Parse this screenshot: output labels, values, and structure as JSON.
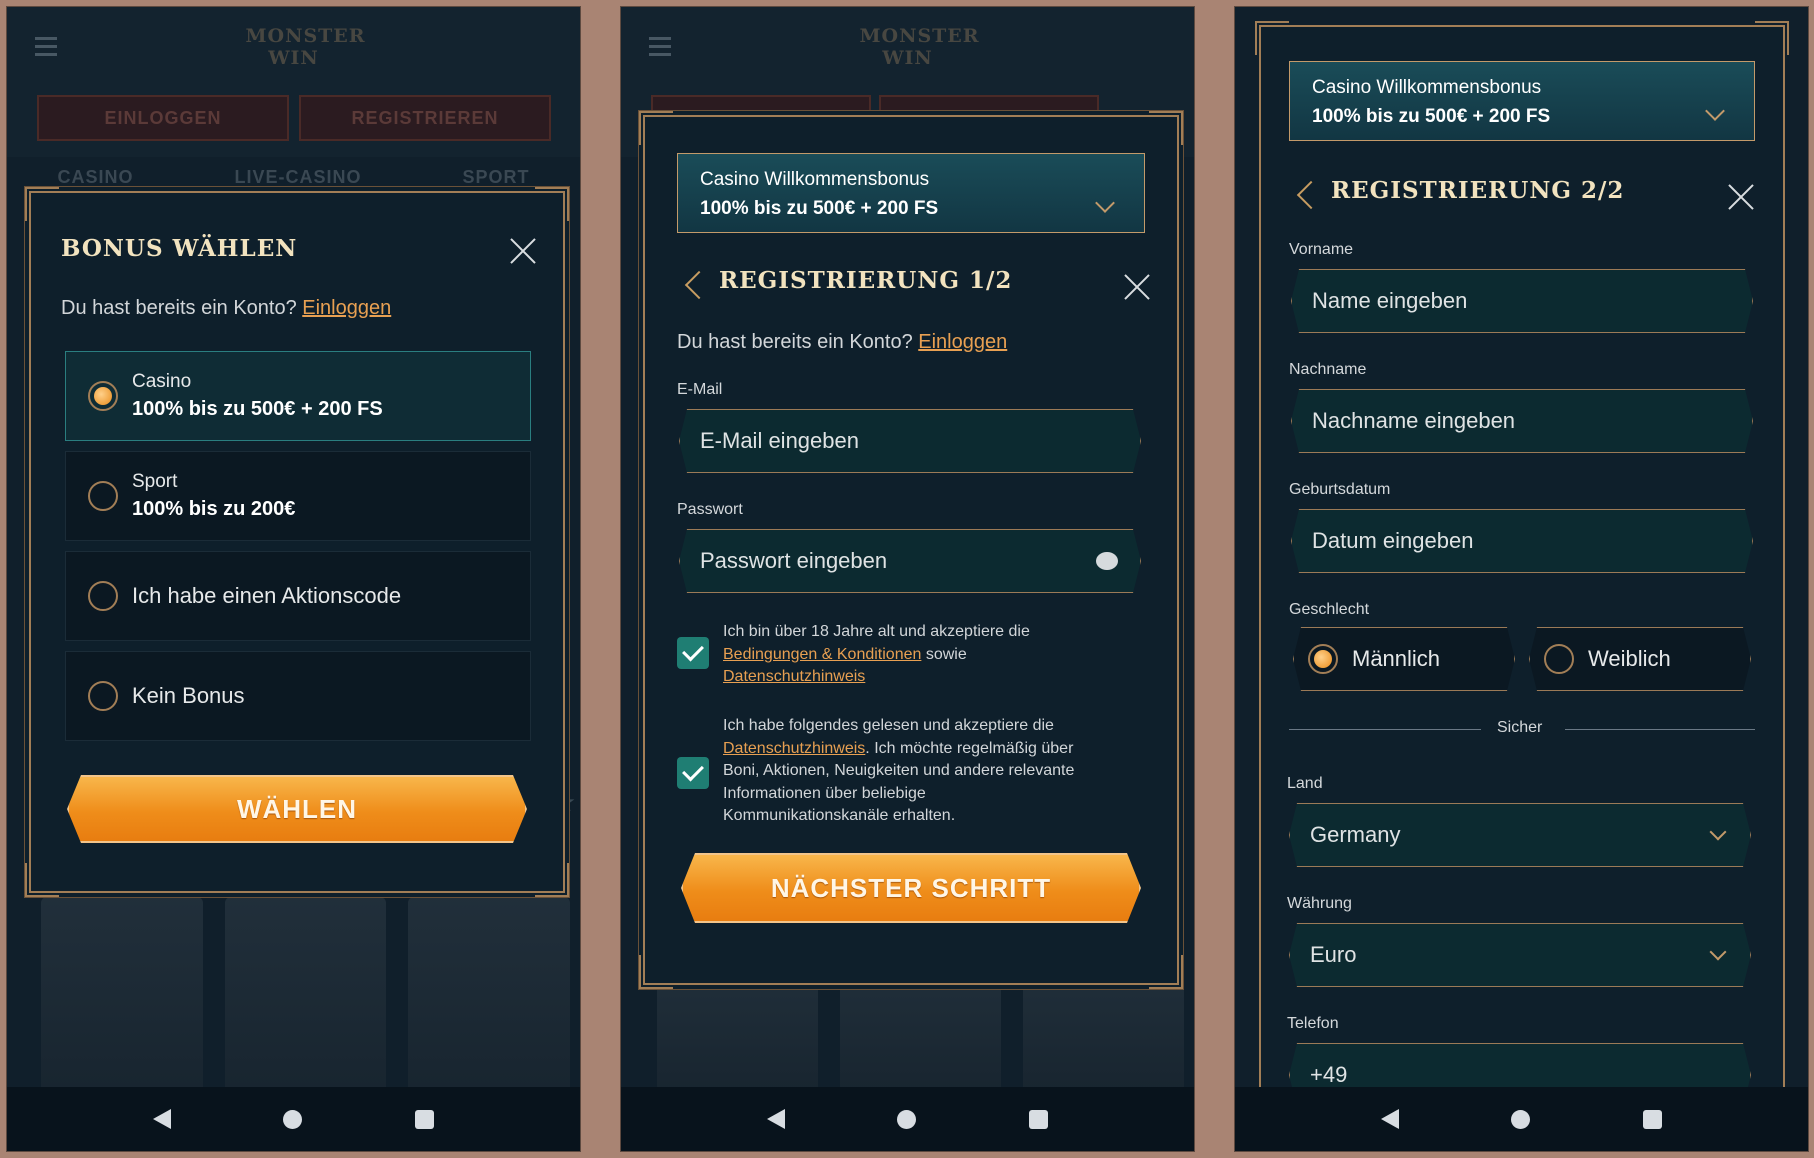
{
  "bg": {
    "einloggen": "EINLOGGEN",
    "registrieren": "REGISTRIEREN",
    "tabs": [
      "CASINO",
      "LIVE-CASINO",
      "SPORT"
    ],
    "logo_line1": "MONSTER",
    "logo_line2": "WIN"
  },
  "screen1": {
    "title": "BONUS WÄHLEN",
    "account_prompt": "Du hast bereits ein Konto?",
    "login_link": "Einloggen",
    "options": [
      {
        "name": "Casino",
        "value": "100% bis zu 500€ + 200 FS",
        "selected": true
      },
      {
        "name": "Sport",
        "value": "100% bis zu 200€",
        "selected": false
      },
      {
        "name": "Ich habe einen Aktionscode",
        "selected": false
      },
      {
        "name": "Kein Bonus",
        "selected": false
      }
    ],
    "cta": "WÄHLEN"
  },
  "screen2": {
    "promo_line1": "Casino Willkommensbonus",
    "promo_line2": "100% bis zu 500€ + 200 FS",
    "title": "REGISTRIERUNG 1/2",
    "account_prompt": "Du hast bereits ein Konto?",
    "login_link": "Einloggen",
    "email_label": "E-Mail",
    "email_placeholder": "E-Mail eingeben",
    "password_label": "Passwort",
    "password_placeholder": "Passwort eingeben",
    "consent1_a": "Ich bin über 18 Jahre alt und akzeptiere die",
    "consent1_link1": "Bedingungen & Konditionen",
    "consent1_b": " sowie",
    "consent1_link2": "Datenschutzhinweis",
    "consent2_a": "Ich habe folgendes gelesen und akzeptiere die",
    "consent2_link": "Datenschutzhinweis",
    "consent2_b": ". Ich möchte regelmäßig über",
    "consent2_c": "Boni, Aktionen, Neuigkeiten und andere relevante",
    "consent2_d": "Informationen über beliebige",
    "consent2_e": "Kommunikationskanäle erhalten.",
    "cta": "NÄCHSTER SCHRITT"
  },
  "screen3": {
    "promo_line1": "Casino Willkommensbonus",
    "promo_line2": "100% bis zu 500€ + 200 FS",
    "title": "REGISTRIERUNG 2/2",
    "firstname_label": "Vorname",
    "firstname_placeholder": "Name eingeben",
    "lastname_label": "Nachname",
    "lastname_placeholder": "Nachname eingeben",
    "dob_label": "Geburtsdatum",
    "dob_placeholder": "Datum eingeben",
    "gender_label": "Geschlecht",
    "male": "Männlich",
    "female": "Weiblich",
    "secure": "Sicher",
    "country_label": "Land",
    "country_value": "Germany",
    "currency_label": "Währung",
    "currency_value": "Euro",
    "phone_label": "Telefon",
    "phone_value": "+49"
  }
}
